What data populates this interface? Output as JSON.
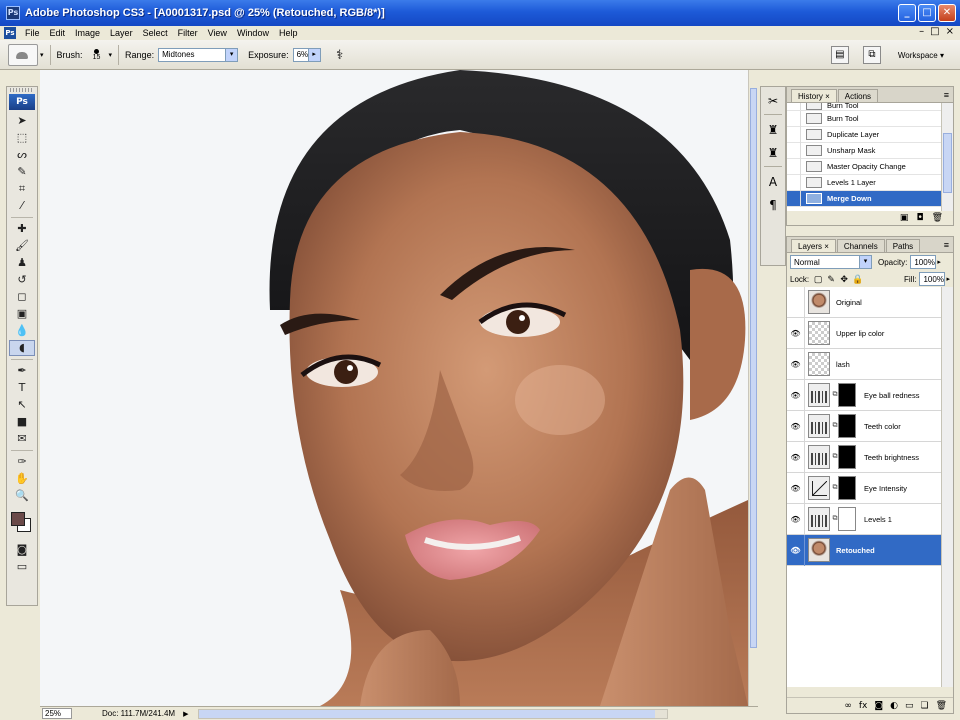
{
  "window": {
    "title": "Adobe Photoshop CS3 - [A0001317.psd @ 25% (Retouched, RGB/8*)]",
    "buttons": [
      "_",
      "□",
      "✕"
    ]
  },
  "menu": {
    "items": [
      "File",
      "Edit",
      "Image",
      "Layer",
      "Select",
      "Filter",
      "View",
      "Window",
      "Help"
    ],
    "doc_buttons": [
      "–",
      "□",
      "×"
    ]
  },
  "options": {
    "brush_label": "Brush:",
    "brush_size": "15",
    "range_label": "Range:",
    "range_value": "Midtones",
    "exposure_label": "Exposure:",
    "exposure_value": "6%",
    "workspace_label": "Workspace ▾"
  },
  "tools": {
    "logo": "Ps",
    "items": [
      {
        "glyph": "➤",
        "name": "move-tool-icon"
      },
      {
        "glyph": "⬚",
        "name": "marquee-tool-icon"
      },
      {
        "glyph": "ᔕ",
        "name": "lasso-tool-icon"
      },
      {
        "glyph": "✎",
        "name": "quick-selection-tool-icon"
      },
      {
        "glyph": "⌗",
        "name": "crop-tool-icon"
      },
      {
        "glyph": "⁄",
        "name": "slice-tool-icon"
      },
      {
        "glyph": "✚",
        "name": "healing-brush-tool-icon"
      },
      {
        "glyph": "🖌",
        "name": "brush-tool-icon"
      },
      {
        "glyph": "♟",
        "name": "clone-stamp-tool-icon"
      },
      {
        "glyph": "↺",
        "name": "history-brush-tool-icon"
      },
      {
        "glyph": "◻",
        "name": "eraser-tool-icon"
      },
      {
        "glyph": "▣",
        "name": "gradient-tool-icon"
      },
      {
        "glyph": "💧",
        "name": "blur-tool-icon"
      },
      {
        "glyph": "◖",
        "name": "burn-tool-icon",
        "active": true
      },
      {
        "glyph": "✒",
        "name": "pen-tool-icon"
      },
      {
        "glyph": "T",
        "name": "type-tool-icon"
      },
      {
        "glyph": "↖",
        "name": "path-selection-tool-icon"
      },
      {
        "glyph": "■",
        "name": "shape-tool-icon"
      },
      {
        "glyph": "✉",
        "name": "notes-tool-icon"
      },
      {
        "glyph": "✑",
        "name": "eyedropper-tool-icon"
      },
      {
        "glyph": "✋",
        "name": "hand-tool-icon"
      },
      {
        "glyph": "🔍",
        "name": "zoom-tool-icon"
      }
    ],
    "foreground_color": "#6b4a49",
    "background_color": "#ffffff"
  },
  "status": {
    "zoom": "25%",
    "doc": "Doc: 111.7M/241.4M"
  },
  "dock": {
    "icons": [
      "✂",
      "♜",
      "♜",
      "A",
      "¶"
    ]
  },
  "history": {
    "tabs": [
      "History ×",
      "Actions"
    ],
    "items": [
      {
        "label": "Burn Tool",
        "state": "partial"
      },
      {
        "label": "Burn Tool",
        "state": ""
      },
      {
        "label": "Duplicate Layer",
        "state": ""
      },
      {
        "label": "Unsharp Mask",
        "state": ""
      },
      {
        "label": "Master Opacity Change",
        "state": ""
      },
      {
        "label": "Levels 1 Layer",
        "state": ""
      },
      {
        "label": "Merge Down",
        "state": "selected"
      }
    ]
  },
  "layers": {
    "tabs": [
      "Layers ×",
      "Channels",
      "Paths"
    ],
    "blend_mode": "Normal",
    "opacity_label": "Opacity:",
    "opacity_value": "100%",
    "lock_label": "Lock:",
    "fill_label": "Fill:",
    "fill_value": "100%",
    "items": [
      {
        "name": "Original",
        "visible": false,
        "thumb": "portrait",
        "mask": null,
        "selected": false
      },
      {
        "name": "Upper lip color",
        "visible": true,
        "thumb": "transparent",
        "mask": null,
        "selected": false
      },
      {
        "name": "lash",
        "visible": true,
        "thumb": "transparent",
        "mask": null,
        "selected": false
      },
      {
        "name": "Eye ball redness",
        "visible": true,
        "thumb": "adjust",
        "mask": "black",
        "selected": false
      },
      {
        "name": "Teeth color",
        "visible": true,
        "thumb": "adjust",
        "mask": "black",
        "selected": false
      },
      {
        "name": "Teeth brightness",
        "visible": true,
        "thumb": "adjust",
        "mask": "black",
        "selected": false
      },
      {
        "name": "Eye Intensity",
        "visible": true,
        "thumb": "curves",
        "mask": "black",
        "selected": false
      },
      {
        "name": "Levels 1",
        "visible": true,
        "thumb": "adjust",
        "mask": "white",
        "selected": false
      },
      {
        "name": "Retouched",
        "visible": true,
        "thumb": "portrait",
        "mask": null,
        "selected": true
      }
    ],
    "footer_icons": [
      "∞",
      "fx",
      "◙",
      "◐",
      "▭",
      "❏",
      "🗑"
    ]
  },
  "canvas": {
    "background": "#f4f6f8"
  }
}
